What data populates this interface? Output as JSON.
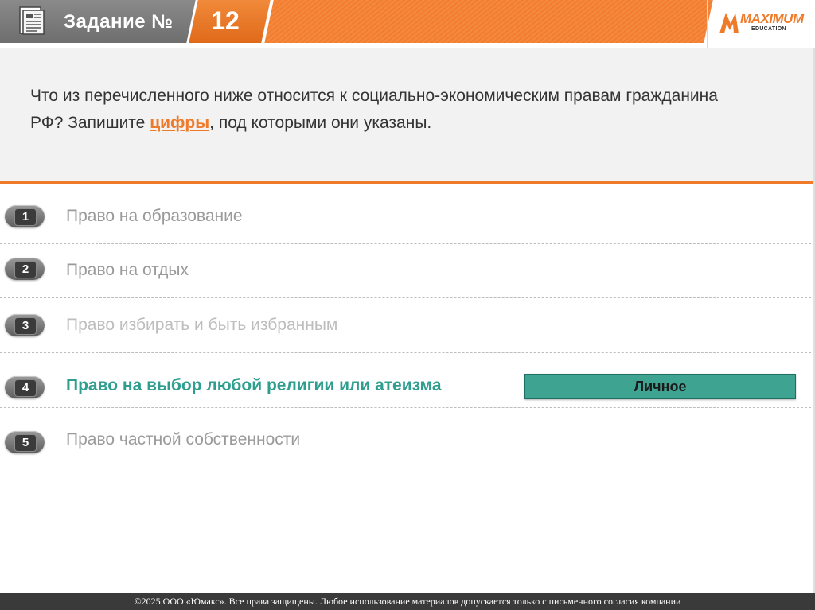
{
  "header": {
    "task_label": "Задание №",
    "task_number": "12",
    "logo": {
      "brand": "MAXIMUM",
      "sub": "EDUCATION"
    }
  },
  "question": {
    "part1": "Что из перечисленного ниже относится к социально-экономическим правам гражданина РФ? Запишите ",
    "highlight": "цифры",
    "part2": ", под которыми они указаны."
  },
  "options": [
    {
      "number": "1",
      "text": "Право на образование"
    },
    {
      "number": "2",
      "text": "Право на отдых"
    },
    {
      "number": "3",
      "text": "Право избирать и быть избранным"
    },
    {
      "number": "4",
      "text": "Право на выбор любой религии или атеизма"
    },
    {
      "number": "5",
      "text": "Право частной собственности"
    }
  ],
  "answer_label": "Личное",
  "footer": "©2025 ООО «Юмакс». Все права защищены. Любое использование материалов допускается только с  письменного согласия компании",
  "colors": {
    "accent": "#ef7b2a",
    "teal": "#3fa391",
    "header_gray": "#7a7a7a"
  }
}
